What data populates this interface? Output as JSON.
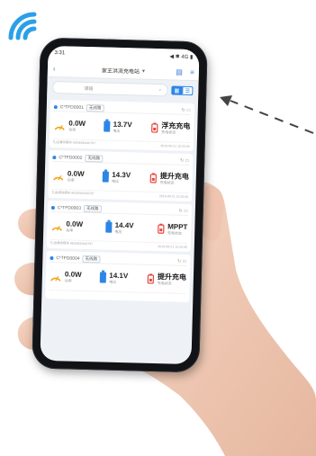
{
  "colors": {
    "accent": "#2d86e6",
    "wifi": "#2aa0e8",
    "warn": "#e8473e",
    "gauge": "#f2a516"
  },
  "icons": [
    "wifi-icon",
    "dashed-arrow-icon",
    "gauge-icon",
    "battery-icon",
    "charger-icon"
  ],
  "phone": {
    "status_time": "3:31",
    "status_right": "◀ ✱ 4G ▮",
    "title": "家王洪流充电站",
    "search_placeholder": "请输",
    "devices": [
      {
        "id": "C¹TFD0001",
        "tag": "无线路",
        "power": "0.0W",
        "power_label": "功率",
        "voltage": "13.7V",
        "voltage_label": "电压",
        "mode": "浮充充电",
        "mode_label": "充电状态",
        "imei": "扎由通信模块 8620000440787",
        "time": "2019-09-21 15:25:05"
      },
      {
        "id": "C¹TFD0002",
        "tag": "无线路",
        "power": "0.0W",
        "power_label": "功率",
        "voltage": "14.3V",
        "voltage_label": "电压",
        "mode": "提升充电",
        "mode_label": "充电状态",
        "imei": "扎由通信模块 8620000440787",
        "time": "2019-09-21 15:25:05"
      },
      {
        "id": "C¹TFD0003",
        "tag": "无线路",
        "power": "0.0W",
        "power_label": "功率",
        "voltage": "14.4V",
        "voltage_label": "电压",
        "mode": "MPPT",
        "mode_label": "充电状态",
        "imei": "扎由通信模块 8620000440787",
        "time": "2019-09-21 15:25:05"
      },
      {
        "id": "C¹TFD0004",
        "tag": "无线路",
        "power": "0.0W",
        "power_label": "功率",
        "voltage": "14.1V",
        "voltage_label": "电压",
        "mode": "提升充电",
        "mode_label": "充电状态",
        "imei": "",
        "time": ""
      }
    ]
  }
}
